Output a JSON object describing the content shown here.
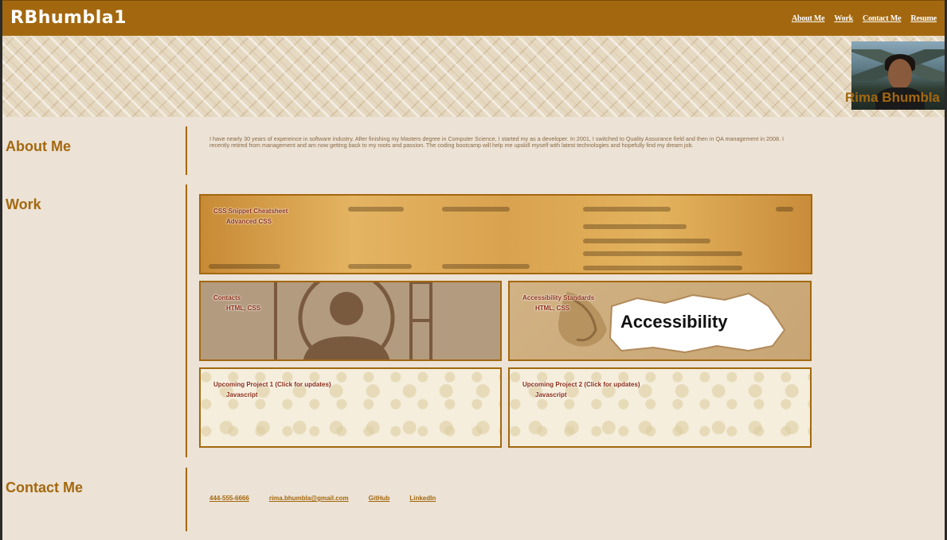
{
  "header": {
    "brand": "RBhumbla1",
    "nav": [
      "About Me",
      "Work",
      "Contact Me",
      "Resume"
    ]
  },
  "hero": {
    "name": "Rima Bhumbla"
  },
  "about": {
    "title": "About Me",
    "text": "I have nearly 30 years of expereince in software industry. After finishing my Masters degree in Computer Science, I started my as a developer. In 2001, I switched to Quality Assurance field and then in QA management in 2008. I recently retired from management and am now getting back to my roots and passion. The coding bootcamp will help me upskill myself with latest technologies and hopefully find my dream job."
  },
  "work": {
    "title": "Work",
    "cards": [
      {
        "title": "CSS Snippet Cheatsheet",
        "tech": "Advanced CSS"
      },
      {
        "title": "Contacts",
        "tech": "HTML, CSS"
      },
      {
        "title": "Accessibility Standards",
        "tech": "HTML, CSS",
        "image_text": "Accessibility"
      },
      {
        "title": "Upcoming Project 1 (Click for updates)",
        "tech": "Javascript"
      },
      {
        "title": "Upcoming Project 2 (Click for updates)",
        "tech": "Javascript"
      }
    ]
  },
  "contact": {
    "title": "Contact Me",
    "links": [
      "444-555-6666",
      "rima.bhumbla@gmail.com",
      "GitHub",
      "LinkedIn"
    ]
  },
  "colors": {
    "accent": "#a3680f",
    "background": "#ece2d5",
    "card_text": "#8a2a10"
  }
}
